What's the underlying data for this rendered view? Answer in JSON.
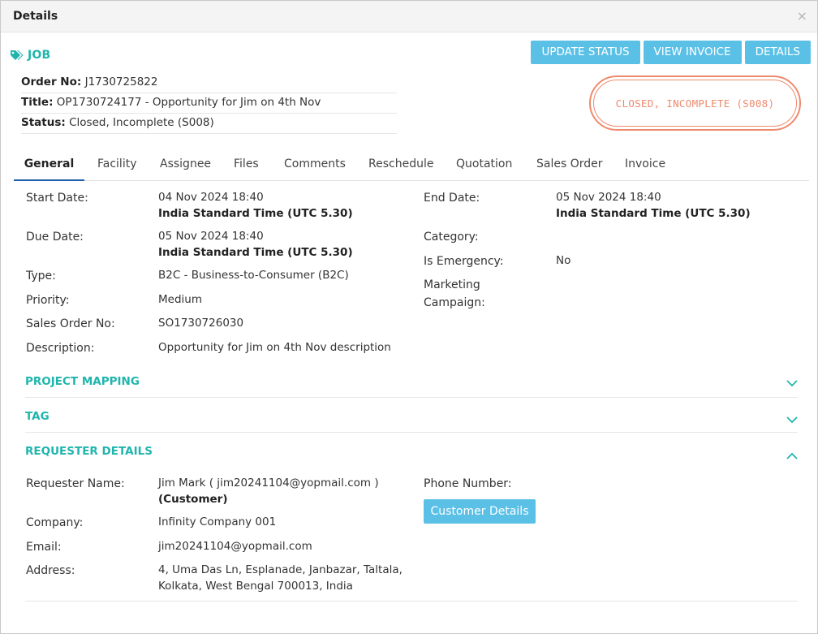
{
  "modal": {
    "title": "Details",
    "close": "×"
  },
  "job": {
    "label": "JOB",
    "order_no_label": "Order No:",
    "order_no": "J1730725822",
    "title_label": "Title:",
    "title": "OP1730724177 - Opportunity for Jim on 4th Nov",
    "status_label": "Status:",
    "status": "Closed, Incomplete (S008)"
  },
  "actions": {
    "update_status": "UPDATE STATUS",
    "view_invoice": "VIEW INVOICE",
    "details": "DETAILS"
  },
  "stamp": {
    "text": "CLOSED, INCOMPLETE (S008)",
    "color": "#ee8a6e"
  },
  "tabs": [
    "General",
    "Facility",
    "Assignee",
    "Files",
    "Comments",
    "Reschedule",
    "Quotation",
    "Sales Order",
    "Invoice"
  ],
  "general": {
    "start_date_label": "Start Date:",
    "start_date": "04 Nov 2024 18:40",
    "start_tz": "India Standard Time (UTC 5.30)",
    "due_date_label": "Due Date:",
    "due_date": "05 Nov 2024 18:40",
    "due_tz": "India Standard Time (UTC 5.30)",
    "type_label": "Type:",
    "type": "B2C - Business-to-Consumer (B2C)",
    "priority_label": "Priority:",
    "priority": "Medium",
    "sales_order_label": "Sales Order No:",
    "sales_order": "SO1730726030",
    "description_label": "Description:",
    "description": "Opportunity for Jim on 4th Nov description",
    "end_date_label": "End Date:",
    "end_date": "05 Nov 2024 18:40",
    "end_tz": "India Standard Time (UTC 5.30)",
    "category_label": "Category:",
    "emergency_label": "Is Emergency:",
    "emergency": "No",
    "marketing_label_1": "Marketing",
    "marketing_label_2": "Campaign:"
  },
  "sections": {
    "project_mapping": "PROJECT MAPPING",
    "tag": "TAG",
    "requester": "REQUESTER DETAILS"
  },
  "requester": {
    "name_label": "Requester Name:",
    "name": "Jim Mark ( jim20241104@yopmail.com )",
    "role": "(Customer)",
    "company_label": "Company:",
    "company": "Infinity Company 001",
    "email_label": "Email:",
    "email": "jim20241104@yopmail.com",
    "address_label": "Address:",
    "address_1": "4, Uma Das Ln, Esplanade, Janbazar, Taltala,",
    "address_2": "Kolkata, West Bengal 700013, India",
    "phone_label": "Phone Number:",
    "customer_details": "Customer Details"
  },
  "colors": {
    "accent": "#1fb5ad",
    "button": "#5bc0e6",
    "active_tab": "#1e5fa8"
  }
}
